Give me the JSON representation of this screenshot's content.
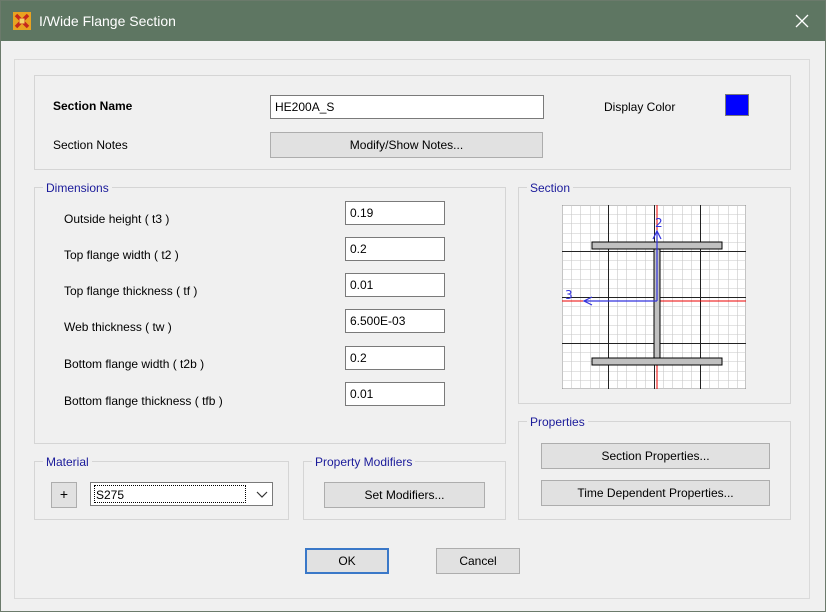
{
  "window": {
    "title": "I/Wide Flange Section",
    "icon": "sap-app-icon",
    "close_icon": "close-icon"
  },
  "section_name": {
    "label": "Section Name",
    "value": "HE200A_S"
  },
  "display_color": {
    "label": "Display Color",
    "color": "#0000ff"
  },
  "section_notes": {
    "label": "Section Notes",
    "button": "Modify/Show Notes..."
  },
  "dimensions": {
    "legend": "Dimensions",
    "fields": [
      {
        "label": "Outside height  ( t3 )",
        "value": "0.19"
      },
      {
        "label": "Top flange width  ( t2 )",
        "value": "0.2"
      },
      {
        "label": "Top flange thickness  ( tf )",
        "value": "0.01"
      },
      {
        "label": "Web thickness  ( tw )",
        "value": "6.500E-03"
      },
      {
        "label": "Bottom flange width  ( t2b )",
        "value": "0.2"
      },
      {
        "label": "Bottom flange thickness  ( tfb )",
        "value": "0.01"
      }
    ]
  },
  "section": {
    "legend": "Section",
    "axis_2": "2",
    "axis_3": "3"
  },
  "properties": {
    "legend": "Properties",
    "section_button": "Section Properties...",
    "time_button": "Time Dependent Properties..."
  },
  "material": {
    "legend": "Material",
    "plus": "+",
    "selected": "S275"
  },
  "property_modifiers": {
    "legend": "Property Modifiers",
    "button": "Set Modifiers..."
  },
  "footer": {
    "ok": "OK",
    "cancel": "Cancel"
  }
}
